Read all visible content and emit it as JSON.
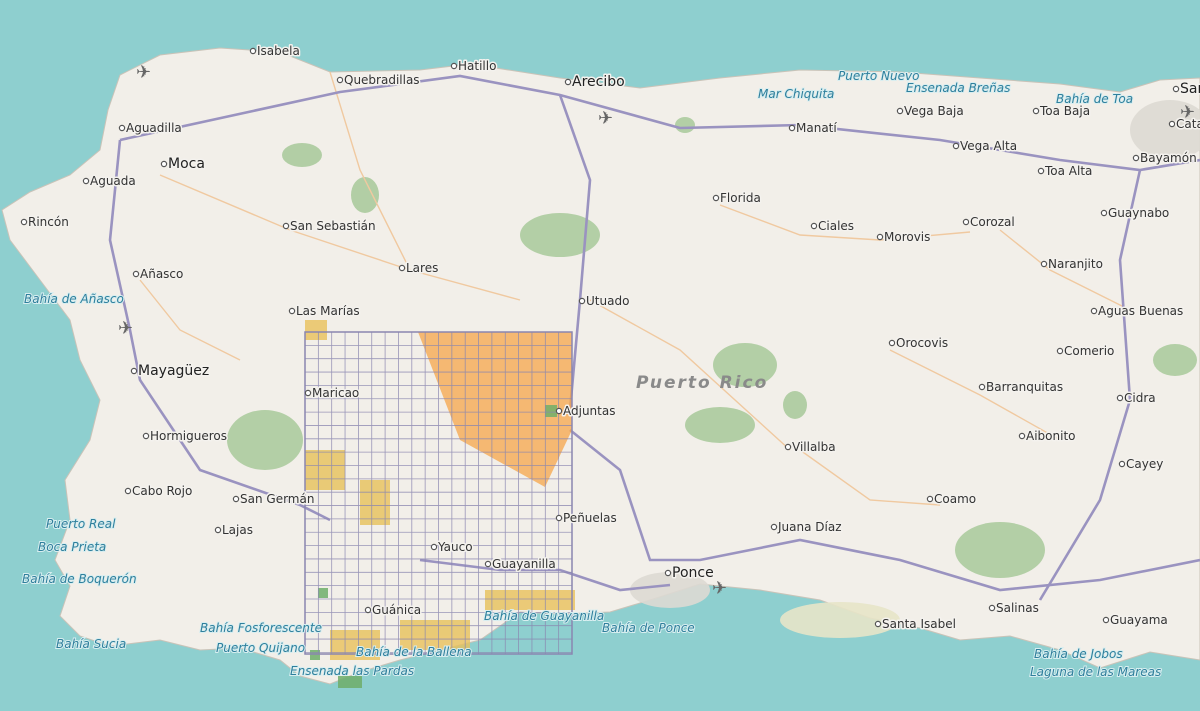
{
  "colors": {
    "sea": "#8ecfcf",
    "land": "#f2efe9",
    "forest": "#a8c99a",
    "road_major": "#9a93c0",
    "road_minor": "#f0c9a0",
    "urban": "#ddd9d3",
    "grid_line": "#8a86b0",
    "tile_orange": "#f5a54a",
    "tile_yellow": "#e8c15a",
    "tile_green": "#6fae6a"
  },
  "map": {
    "island_name": "Puerto Rico",
    "cities": [
      {
        "name": "Isabela",
        "big": false
      },
      {
        "name": "Quebradillas",
        "big": false
      },
      {
        "name": "Hatillo",
        "big": false
      },
      {
        "name": "Arecibo",
        "big": true
      },
      {
        "name": "Aguadilla",
        "big": false
      },
      {
        "name": "Moca",
        "big": true
      },
      {
        "name": "Aguada",
        "big": false
      },
      {
        "name": "Rincón",
        "big": false
      },
      {
        "name": "San Sebastián",
        "big": false
      },
      {
        "name": "Lares",
        "big": false
      },
      {
        "name": "Añasco",
        "big": false
      },
      {
        "name": "Las Marías",
        "big": false
      },
      {
        "name": "Mayagüez",
        "big": true
      },
      {
        "name": "Maricao",
        "big": false
      },
      {
        "name": "Hormigueros",
        "big": false
      },
      {
        "name": "Cabo Rojo",
        "big": false
      },
      {
        "name": "San Germán",
        "big": false
      },
      {
        "name": "Lajas",
        "big": false
      },
      {
        "name": "Yauco",
        "big": false
      },
      {
        "name": "Guayanilla",
        "big": false
      },
      {
        "name": "Guánica",
        "big": false
      },
      {
        "name": "Utuado",
        "big": false
      },
      {
        "name": "Adjuntas",
        "big": false
      },
      {
        "name": "Peñuelas",
        "big": false
      },
      {
        "name": "Ponce",
        "big": true
      },
      {
        "name": "Manatí",
        "big": false
      },
      {
        "name": "Vega Baja",
        "big": false
      },
      {
        "name": "Toa Baja",
        "big": false
      },
      {
        "name": "Vega Alta",
        "big": false
      },
      {
        "name": "Toa Alta",
        "big": false
      },
      {
        "name": "Bayamón",
        "big": false
      },
      {
        "name": "Guaynabo",
        "big": false
      },
      {
        "name": "Florida",
        "big": false
      },
      {
        "name": "Ciales",
        "big": false
      },
      {
        "name": "Morovis",
        "big": false
      },
      {
        "name": "Corozal",
        "big": false
      },
      {
        "name": "Naranjito",
        "big": false
      },
      {
        "name": "Aguas Buenas",
        "big": false
      },
      {
        "name": "Orocovis",
        "big": false
      },
      {
        "name": "Comerio",
        "big": false
      },
      {
        "name": "Barranquitas",
        "big": false
      },
      {
        "name": "Cidra",
        "big": false
      },
      {
        "name": "Villalba",
        "big": false
      },
      {
        "name": "Aibonito",
        "big": false
      },
      {
        "name": "Cayey",
        "big": false
      },
      {
        "name": "Coamo",
        "big": false
      },
      {
        "name": "Juana Díaz",
        "big": false
      },
      {
        "name": "Santa Isabel",
        "big": false
      },
      {
        "name": "Salinas",
        "big": false
      },
      {
        "name": "Guayama",
        "big": false
      },
      {
        "name": "San",
        "big": true
      },
      {
        "name": "Cata",
        "big": false
      }
    ],
    "water_labels": [
      "Puerto Nuevo",
      "Mar Chiquita",
      "Ensenada Breñas",
      "Bahía de Toa",
      "Bahía de Añasco",
      "Puerto Real",
      "Boca Prieta",
      "Bahía de Boquerón",
      "Bahía Sucia",
      "Bahía Fosforescente",
      "Puerto Quijano",
      "Bahía de la Ballena",
      "Ensenada las Pardas",
      "Bahía de Guayanilla",
      "Bahía de Ponce",
      "Bahía de Jobos",
      "Laguna de las Mareas"
    ]
  }
}
